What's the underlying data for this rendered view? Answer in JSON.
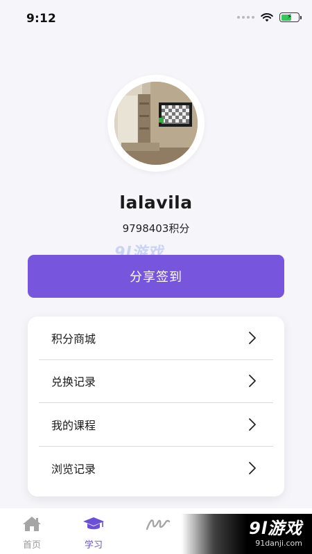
{
  "status_bar": {
    "time": "9:12"
  },
  "profile": {
    "username": "lalavila",
    "points": "9798403积分"
  },
  "watermark": {
    "logo": "9l游戏",
    "sub": "91danji.com"
  },
  "actions": {
    "share_checkin_label": "分享签到"
  },
  "menu": {
    "items": [
      {
        "label": "积分商城"
      },
      {
        "label": "兑换记录"
      },
      {
        "label": "我的课程"
      },
      {
        "label": "浏览记录"
      }
    ]
  },
  "tab_bar": {
    "tabs": [
      {
        "label": "首页",
        "icon": "home-icon",
        "active": false
      },
      {
        "label": "学习",
        "icon": "graduation-cap-icon",
        "active": true
      },
      {
        "label": "",
        "icon": "signature-icon",
        "active": false
      }
    ]
  },
  "colors": {
    "accent": "#7855dd",
    "active_tab": "#6b4fd8",
    "background": "#f5f5fa",
    "battery": "#34c759"
  },
  "battery_level": 0.6
}
